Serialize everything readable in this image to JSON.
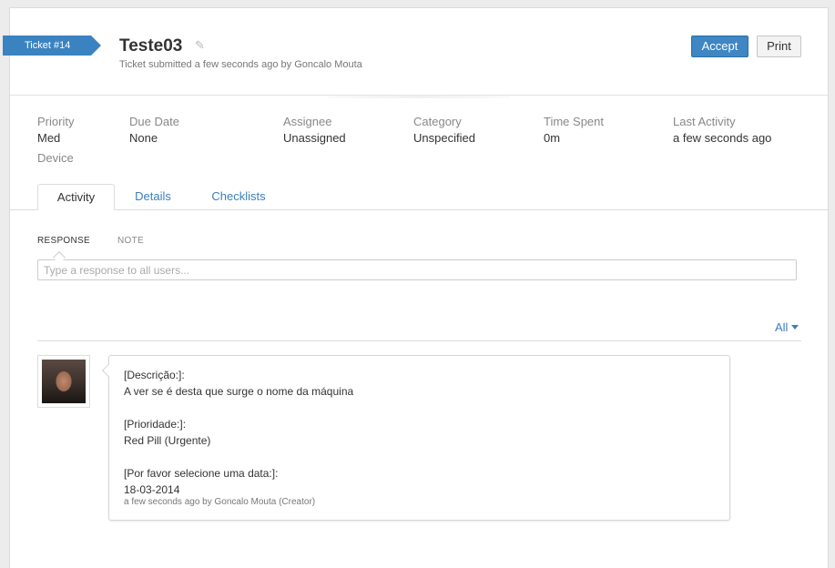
{
  "header": {
    "ticket_label": "Ticket #14",
    "title": "Teste03",
    "subtitle": "Ticket submitted a few seconds ago by Goncalo Mouta",
    "accept_label": "Accept",
    "print_label": "Print"
  },
  "properties": [
    {
      "label": "Priority",
      "value": "Med"
    },
    {
      "label": "Due Date",
      "value": "None"
    },
    {
      "label": "Assignee",
      "value": "Unassigned"
    },
    {
      "label": "Category",
      "value": "Unspecified"
    },
    {
      "label": "Time Spent",
      "value": "0m"
    },
    {
      "label": "Last Activity",
      "value": "a few seconds ago"
    }
  ],
  "device_label": "Device",
  "tabs": [
    "Activity",
    "Details",
    "Checklists"
  ],
  "response": {
    "tabs": [
      "RESPONSE",
      "NOTE"
    ],
    "placeholder": "Type a response to all users..."
  },
  "filter_label": "All",
  "activity": {
    "lines": [
      "[Descrição:]:",
      "A ver se é desta que surge o nome da máquina",
      "[Prioridade:]:",
      "Red Pill (Urgente)",
      "[Por favor selecione uma data:]:",
      "18-03-2014"
    ],
    "meta": "a few seconds ago by Goncalo Mouta (Creator)"
  }
}
